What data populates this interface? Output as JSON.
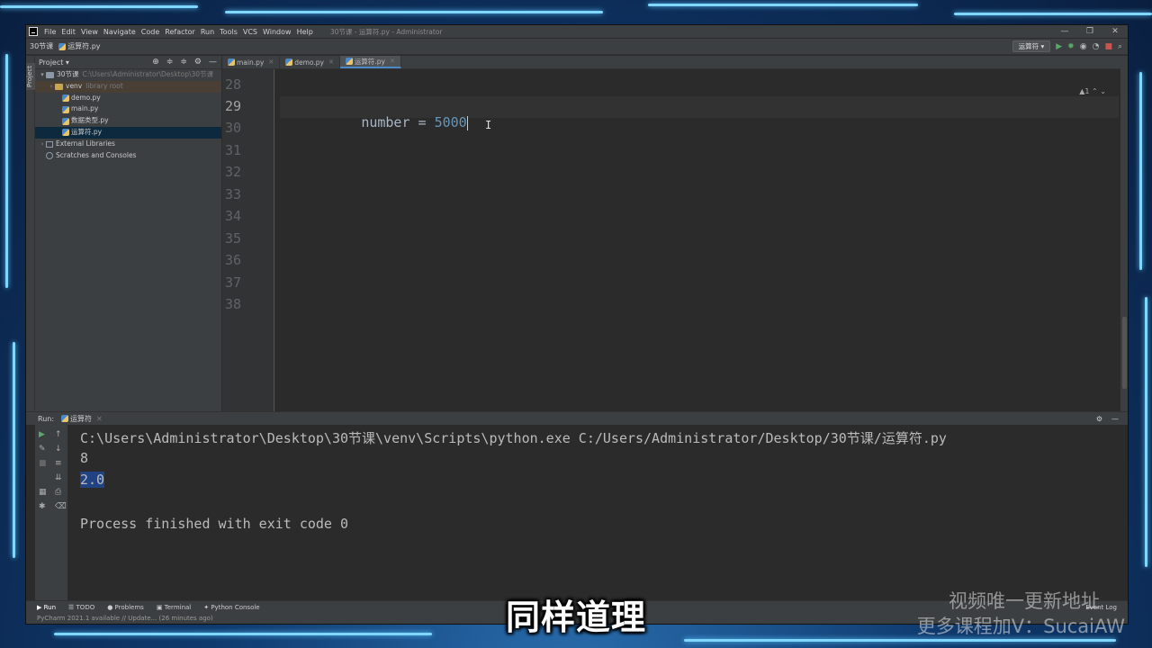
{
  "app": {
    "menu": [
      "File",
      "Edit",
      "View",
      "Navigate",
      "Code",
      "Refactor",
      "Run",
      "Tools",
      "VCS",
      "Window",
      "Help"
    ],
    "window_title": "30节课 - 运算符.py - Administrator"
  },
  "navbar": {
    "project": "30节课",
    "file": "运算符.py",
    "run_config": "运算符 ▾"
  },
  "project_panel": {
    "title": "Project ▾",
    "side_label": "Project",
    "root": "30节课",
    "root_path": "C:\\Users\\Administrator\\Desktop\\30节课",
    "venv": "venv",
    "venv_note": "library root",
    "files": [
      "demo.py",
      "main.py",
      "数据类型.py",
      "运算符.py"
    ],
    "external": "External Libraries",
    "scratches": "Scratches and Consoles"
  },
  "editor": {
    "tabs": [
      "main.py",
      "demo.py",
      "运算符.py"
    ],
    "line_numbers": [
      "28",
      "29",
      "30",
      "31",
      "32",
      "33",
      "34",
      "35",
      "36",
      "37",
      "38"
    ],
    "code_ident": "number = ",
    "code_value": "5000",
    "inspection": "▲1 ⌃ ⌄"
  },
  "run": {
    "label": "Run:",
    "tab": "运算符",
    "command": "C:\\Users\\Administrator\\Desktop\\30节课\\venv\\Scripts\\python.exe C:/Users/Administrator/Desktop/30节课/运算符.py",
    "out1": "8",
    "out2": "2.0",
    "exit": "Process finished with exit code 0"
  },
  "bottom_tabs": {
    "run": "▶ Run",
    "todo": "☰ TODO",
    "problems": "● Problems",
    "terminal": "▣ Terminal",
    "console": "✦ Python Console",
    "event_log": "Event Log"
  },
  "status": "PyCharm 2021.1 available // Update... (26 minutes ago)",
  "overlay": {
    "subtitle": "同样道理",
    "watermark1": "视频唯一更新地址",
    "watermark2": "更多课程加V：SucaiAW"
  }
}
